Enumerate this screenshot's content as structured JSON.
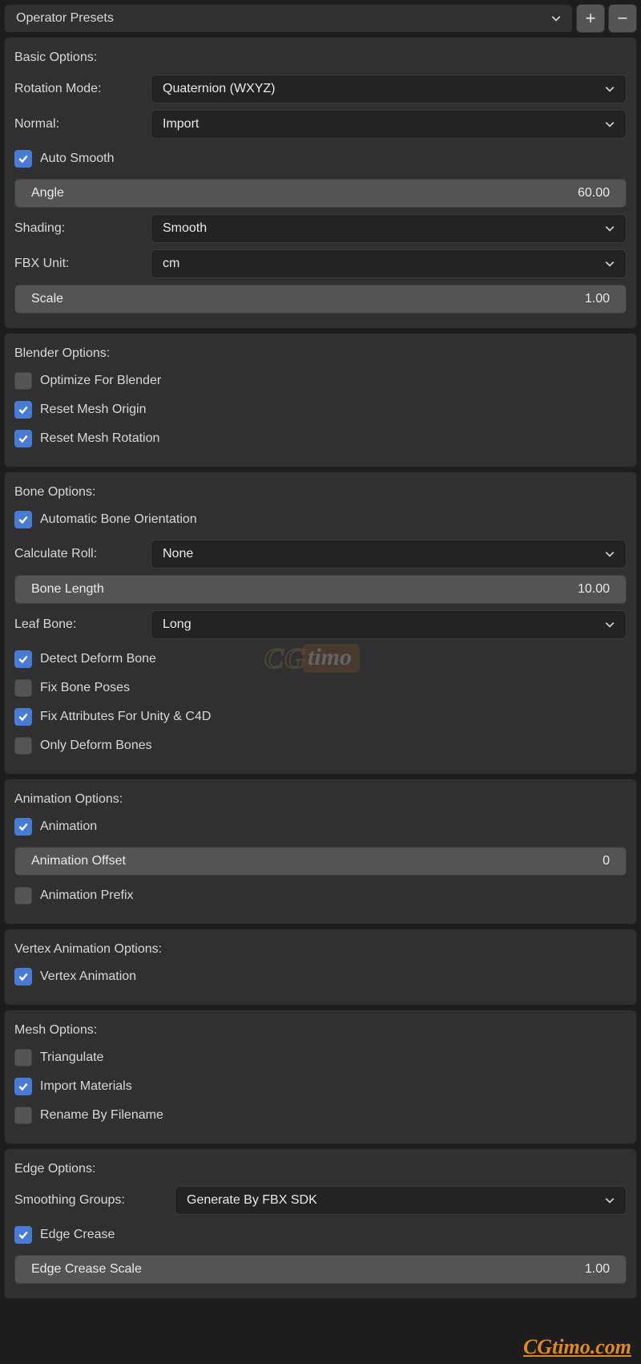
{
  "presets": {
    "label": "Operator Presets"
  },
  "basic": {
    "title": "Basic Options:",
    "rotation_mode_label": "Rotation Mode:",
    "rotation_mode_value": "Quaternion (WXYZ)",
    "normal_label": "Normal:",
    "normal_value": "Import",
    "auto_smooth": "Auto Smooth",
    "angle_label": "Angle",
    "angle_value": "60.00",
    "shading_label": "Shading:",
    "shading_value": "Smooth",
    "fbx_unit_label": "FBX Unit:",
    "fbx_unit_value": "cm",
    "scale_label": "Scale",
    "scale_value": "1.00"
  },
  "blender": {
    "title": "Blender Options:",
    "optimize": "Optimize For Blender",
    "reset_origin": "Reset Mesh Origin",
    "reset_rotation": "Reset Mesh Rotation"
  },
  "bone": {
    "title": "Bone Options:",
    "auto_orient": "Automatic Bone Orientation",
    "calc_roll_label": "Calculate Roll:",
    "calc_roll_value": "None",
    "bone_length_label": "Bone Length",
    "bone_length_value": "10.00",
    "leaf_bone_label": "Leaf Bone:",
    "leaf_bone_value": "Long",
    "detect_deform": "Detect Deform Bone",
    "fix_bone_poses": "Fix Bone Poses",
    "fix_attr": "Fix Attributes For Unity & C4D",
    "only_deform": "Only Deform Bones"
  },
  "anim": {
    "title": "Animation Options:",
    "animation": "Animation",
    "offset_label": "Animation Offset",
    "offset_value": "0",
    "prefix": "Animation Prefix"
  },
  "vanim": {
    "title": "Vertex Animation Options:",
    "vertex_animation": "Vertex Animation"
  },
  "mesh": {
    "title": "Mesh Options:",
    "triangulate": "Triangulate",
    "import_materials": "Import Materials",
    "rename": "Rename By Filename"
  },
  "edge": {
    "title": "Edge Options:",
    "smoothing_label": "Smoothing Groups:",
    "smoothing_value": "Generate By FBX SDK",
    "edge_crease": "Edge Crease",
    "crease_scale_label": "Edge Crease Scale",
    "crease_scale_value": "1.00"
  },
  "watermark": {
    "cg": "CG",
    "timo": "timo",
    "url": "CGtimo.com"
  }
}
